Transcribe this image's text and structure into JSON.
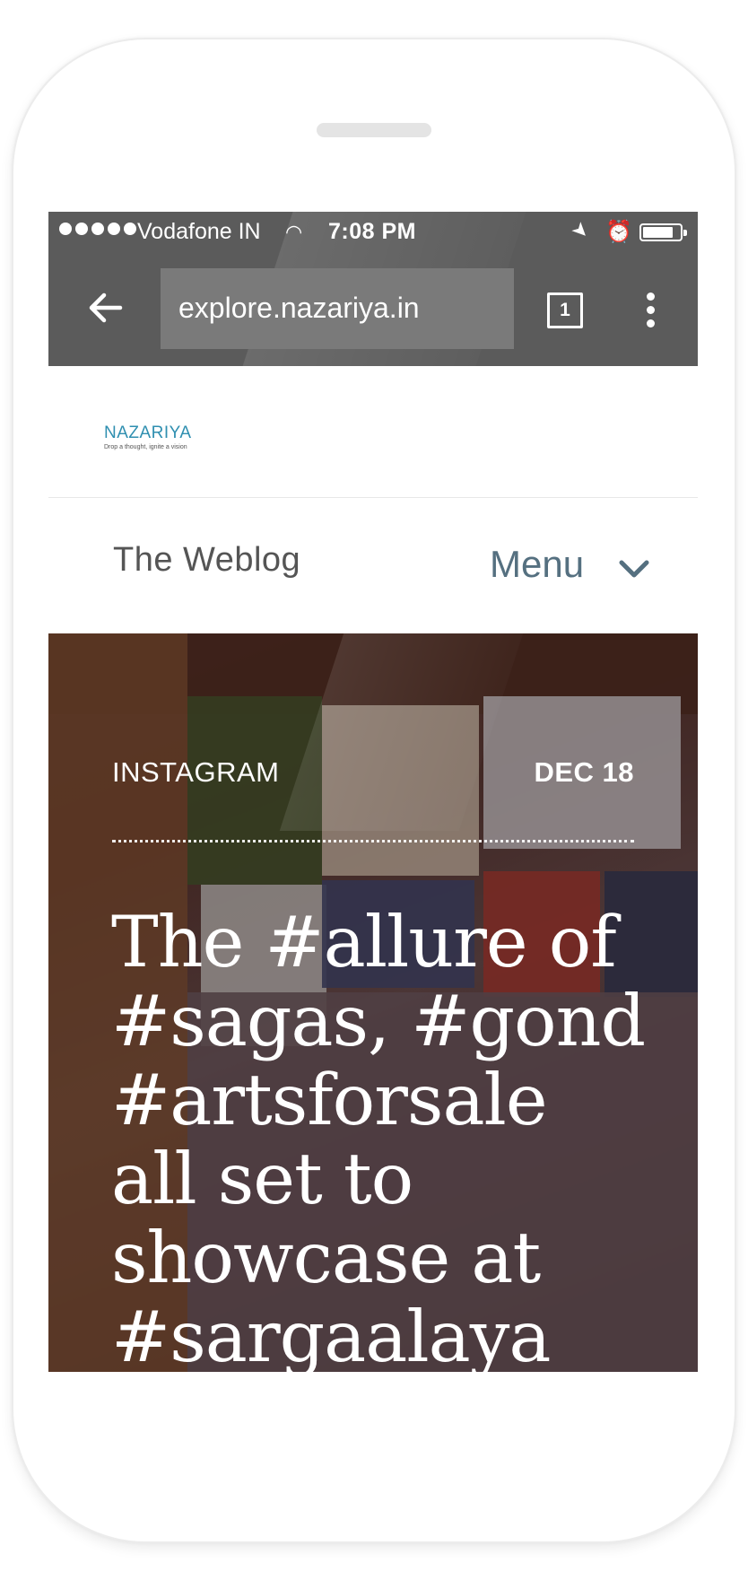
{
  "statusbar": {
    "carrier": "Vodafone IN",
    "time": "7:08 PM",
    "battery_level": 0.85
  },
  "browser": {
    "url": "explore.nazariya.in",
    "tab_count": "1"
  },
  "site": {
    "logo_name": "NAZARIYA",
    "logo_tagline": "Drop a thought, ignite a vision"
  },
  "nav": {
    "title": "The Weblog",
    "menu_label": "Menu"
  },
  "post": {
    "category": "INSTAGRAM",
    "date": "DEC 18",
    "title": "The #allure of #sagas, #gond #artsforsale all set to showcase at #sargaalaya"
  },
  "icons": [
    "signal-icon",
    "wifi-icon",
    "location-icon",
    "alarm-icon",
    "battery-icon",
    "back-arrow-icon",
    "tabs-icon",
    "overflow-menu-icon",
    "chevron-down-icon"
  ]
}
